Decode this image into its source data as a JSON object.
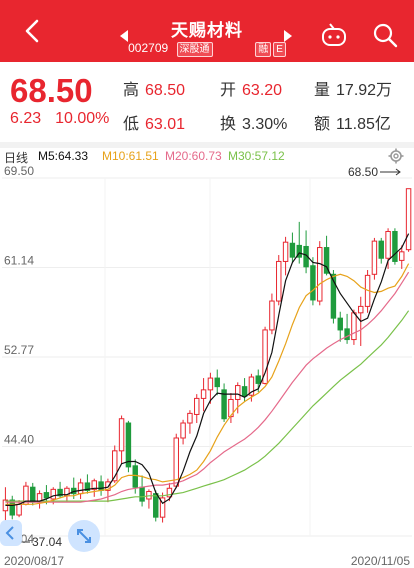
{
  "header": {
    "title": "天赐材料",
    "code": "002709",
    "tag1": "深股通",
    "tag2": "融",
    "tag3": "E"
  },
  "quote": {
    "price": "68.50",
    "change": "6.23",
    "change_pct": "10.00%",
    "high_label": "高",
    "high": "68.50",
    "open_label": "开",
    "open": "63.20",
    "volume_label": "量",
    "volume": "17.92万",
    "low_label": "低",
    "low": "63.01",
    "turnover_label": "换",
    "turnover": "3.30%",
    "amount_label": "额",
    "amount": "11.85亿"
  },
  "ma": {
    "period": "日线",
    "m5": "M5:64.33",
    "m10": "M10:61.51",
    "m20": "M20:60.73",
    "m30": "M30:57.12"
  },
  "colors": {
    "red": "#e8262f",
    "green": "#1f9b3d",
    "m5": "#111111",
    "m10": "#e7a21a",
    "m20": "#e56a8b",
    "m30": "#7ac14a"
  },
  "chart_data": {
    "type": "candlestick",
    "y_ticks": [
      "69.50",
      "61.14",
      "52.77",
      "44.40",
      "36.04"
    ],
    "y_range": [
      36.04,
      69.5
    ],
    "high_label": "68.50",
    "low_label": "37.04",
    "x_start": "2020/08/17",
    "x_end": "2020/11/05",
    "candles": [
      [
        38.4,
        40.6,
        37.0,
        39.4,
        0
      ],
      [
        39.4,
        39.8,
        37.6,
        38.0,
        1
      ],
      [
        38.0,
        39.4,
        37.8,
        39.0,
        0
      ],
      [
        39.0,
        41.1,
        38.9,
        40.7,
        0
      ],
      [
        40.6,
        41.0,
        38.9,
        39.2,
        1
      ],
      [
        39.2,
        40.3,
        38.6,
        40.0,
        0
      ],
      [
        40.1,
        40.8,
        39.0,
        39.6,
        1
      ],
      [
        39.5,
        40.6,
        39.0,
        40.4,
        0
      ],
      [
        40.4,
        41.1,
        39.6,
        39.8,
        1
      ],
      [
        39.8,
        40.7,
        39.2,
        40.5,
        0
      ],
      [
        40.5,
        41.5,
        39.5,
        40.0,
        1
      ],
      [
        40.0,
        41.4,
        39.5,
        41.0,
        0
      ],
      [
        41.0,
        41.8,
        40.0,
        40.3,
        1
      ],
      [
        40.4,
        41.4,
        39.7,
        41.2,
        0
      ],
      [
        41.1,
        41.7,
        39.8,
        40.3,
        1
      ],
      [
        40.3,
        41.4,
        39.2,
        41.1,
        0
      ],
      [
        41.2,
        44.5,
        41.0,
        44.0,
        0
      ],
      [
        44.0,
        47.3,
        42.8,
        47.0,
        0
      ],
      [
        46.6,
        46.8,
        42.0,
        42.5,
        1
      ],
      [
        42.6,
        43.2,
        40.0,
        40.6,
        1
      ],
      [
        40.6,
        41.7,
        38.8,
        39.3,
        1
      ],
      [
        39.5,
        40.4,
        38.6,
        40.2,
        0
      ],
      [
        40.0,
        40.3,
        37.4,
        37.8,
        1
      ],
      [
        37.8,
        40.1,
        37.3,
        39.6,
        0
      ],
      [
        39.7,
        41.0,
        39.3,
        40.5,
        0
      ],
      [
        40.7,
        45.6,
        40.5,
        45.2,
        0
      ],
      [
        45.2,
        46.9,
        44.6,
        46.6,
        0
      ],
      [
        46.6,
        47.8,
        45.6,
        47.5,
        0
      ],
      [
        47.4,
        49.3,
        46.6,
        48.9,
        0
      ],
      [
        48.9,
        50.8,
        47.7,
        49.7,
        0
      ],
      [
        49.7,
        51.3,
        48.4,
        50.8,
        0
      ],
      [
        50.8,
        51.6,
        49.2,
        50.0,
        1
      ],
      [
        49.7,
        50.3,
        46.7,
        47.0,
        1
      ],
      [
        47.2,
        49.4,
        46.6,
        48.8,
        0
      ],
      [
        48.8,
        50.4,
        47.5,
        50.1,
        0
      ],
      [
        50.0,
        50.8,
        48.6,
        49.1,
        1
      ],
      [
        49.2,
        51.2,
        48.6,
        50.9,
        0
      ],
      [
        51.0,
        51.6,
        49.5,
        50.3,
        1
      ],
      [
        50.3,
        55.6,
        50.2,
        55.3,
        0
      ],
      [
        55.3,
        58.7,
        54.9,
        58.0,
        0
      ],
      [
        58.0,
        62.3,
        57.6,
        61.7,
        0
      ],
      [
        61.7,
        64.0,
        60.4,
        63.5,
        0
      ],
      [
        63.4,
        64.4,
        61.6,
        62.1,
        1
      ],
      [
        62.1,
        65.4,
        61.5,
        63.2,
        1
      ],
      [
        63.1,
        64.6,
        60.6,
        61.2,
        1
      ],
      [
        61.3,
        62.1,
        57.6,
        58.1,
        1
      ],
      [
        58.0,
        63.6,
        57.6,
        63.0,
        0
      ],
      [
        63.0,
        64.1,
        60.4,
        60.6,
        1
      ],
      [
        60.5,
        60.9,
        55.9,
        56.4,
        1
      ],
      [
        56.4,
        57.0,
        54.2,
        55.3,
        1
      ],
      [
        55.4,
        56.8,
        54.0,
        54.4,
        1
      ],
      [
        54.4,
        57.2,
        53.9,
        56.9,
        0
      ],
      [
        56.9,
        58.4,
        53.8,
        57.5,
        0
      ],
      [
        57.5,
        60.9,
        56.9,
        60.4,
        0
      ],
      [
        60.5,
        63.9,
        60.0,
        63.6,
        0
      ],
      [
        63.6,
        63.9,
        61.5,
        62.0,
        1
      ],
      [
        62.0,
        64.8,
        61.0,
        64.5,
        0
      ],
      [
        64.5,
        64.8,
        61.4,
        61.7,
        1
      ],
      [
        61.8,
        63.2,
        61.0,
        62.6,
        0
      ],
      [
        62.8,
        68.5,
        62.6,
        68.5,
        0
      ]
    ],
    "ma5": [
      38.9,
      38.9,
      39.0,
      39.3,
      39.3,
      39.3,
      39.5,
      39.8,
      39.9,
      39.9,
      40.2,
      40.3,
      40.4,
      40.5,
      40.5,
      40.6,
      41.6,
      42.8,
      43.0,
      43.0,
      42.7,
      41.9,
      40.1,
      39.1,
      39.5,
      40.6,
      42.1,
      43.9,
      45.4,
      47.5,
      48.7,
      49.4,
      49.3,
      49.3,
      49.3,
      49.0,
      49.5,
      49.8,
      51.3,
      53.2,
      56.7,
      59.9,
      61.6,
      62.5,
      62.3,
      61.6,
      61.5,
      61.2,
      59.9,
      58.7,
      57.8,
      56.9,
      56.1,
      56.4,
      58.2,
      59.8,
      61.8,
      62.4,
      63.0,
      64.3
    ],
    "ma10": [
      39.0,
      39.0,
      39.0,
      39.0,
      39.0,
      39.1,
      39.2,
      39.4,
      39.6,
      39.8,
      39.8,
      40.0,
      40.1,
      40.2,
      40.3,
      40.4,
      40.8,
      41.5,
      41.7,
      41.7,
      41.6,
      41.4,
      41.3,
      41.1,
      41.2,
      41.3,
      41.5,
      41.8,
      42.2,
      43.0,
      44.0,
      45.3,
      46.4,
      47.3,
      48.1,
      48.6,
      49.0,
      49.4,
      50.0,
      50.9,
      52.4,
      54.0,
      55.8,
      57.4,
      58.5,
      59.0,
      59.6,
      60.0,
      60.3,
      60.5,
      60.3,
      59.9,
      59.3,
      59.0,
      58.8,
      58.9,
      59.2,
      59.4,
      60.3,
      61.5
    ],
    "ma20": [
      39.2,
      39.2,
      39.2,
      39.2,
      39.2,
      39.2,
      39.2,
      39.2,
      39.2,
      39.2,
      39.2,
      39.2,
      39.3,
      39.4,
      39.5,
      39.7,
      39.9,
      40.2,
      40.4,
      40.5,
      40.6,
      40.7,
      40.8,
      40.8,
      40.9,
      41.0,
      41.2,
      41.5,
      41.8,
      42.3,
      42.9,
      43.4,
      43.9,
      44.3,
      44.7,
      45.1,
      45.6,
      46.2,
      46.9,
      47.7,
      48.6,
      49.5,
      50.4,
      51.2,
      52.0,
      52.6,
      53.1,
      53.6,
      54.0,
      54.4,
      54.7,
      55.0,
      55.3,
      55.8,
      56.4,
      57.1,
      57.9,
      58.7,
      59.7,
      60.7
    ],
    "ma30": [
      39.3,
      39.3,
      39.3,
      39.3,
      39.3,
      39.3,
      39.3,
      39.3,
      39.3,
      39.3,
      39.3,
      39.3,
      39.3,
      39.3,
      39.3,
      39.3,
      39.4,
      39.5,
      39.6,
      39.7,
      39.7,
      39.8,
      39.8,
      39.8,
      39.9,
      40.0,
      40.1,
      40.3,
      40.5,
      40.7,
      40.9,
      41.1,
      41.3,
      41.6,
      41.9,
      42.2,
      42.6,
      43.0,
      43.5,
      44.1,
      44.7,
      45.4,
      46.1,
      46.8,
      47.5,
      48.2,
      48.8,
      49.4,
      50.0,
      50.6,
      51.1,
      51.6,
      52.1,
      52.7,
      53.3,
      53.9,
      54.6,
      55.4,
      56.2,
      57.1
    ]
  }
}
